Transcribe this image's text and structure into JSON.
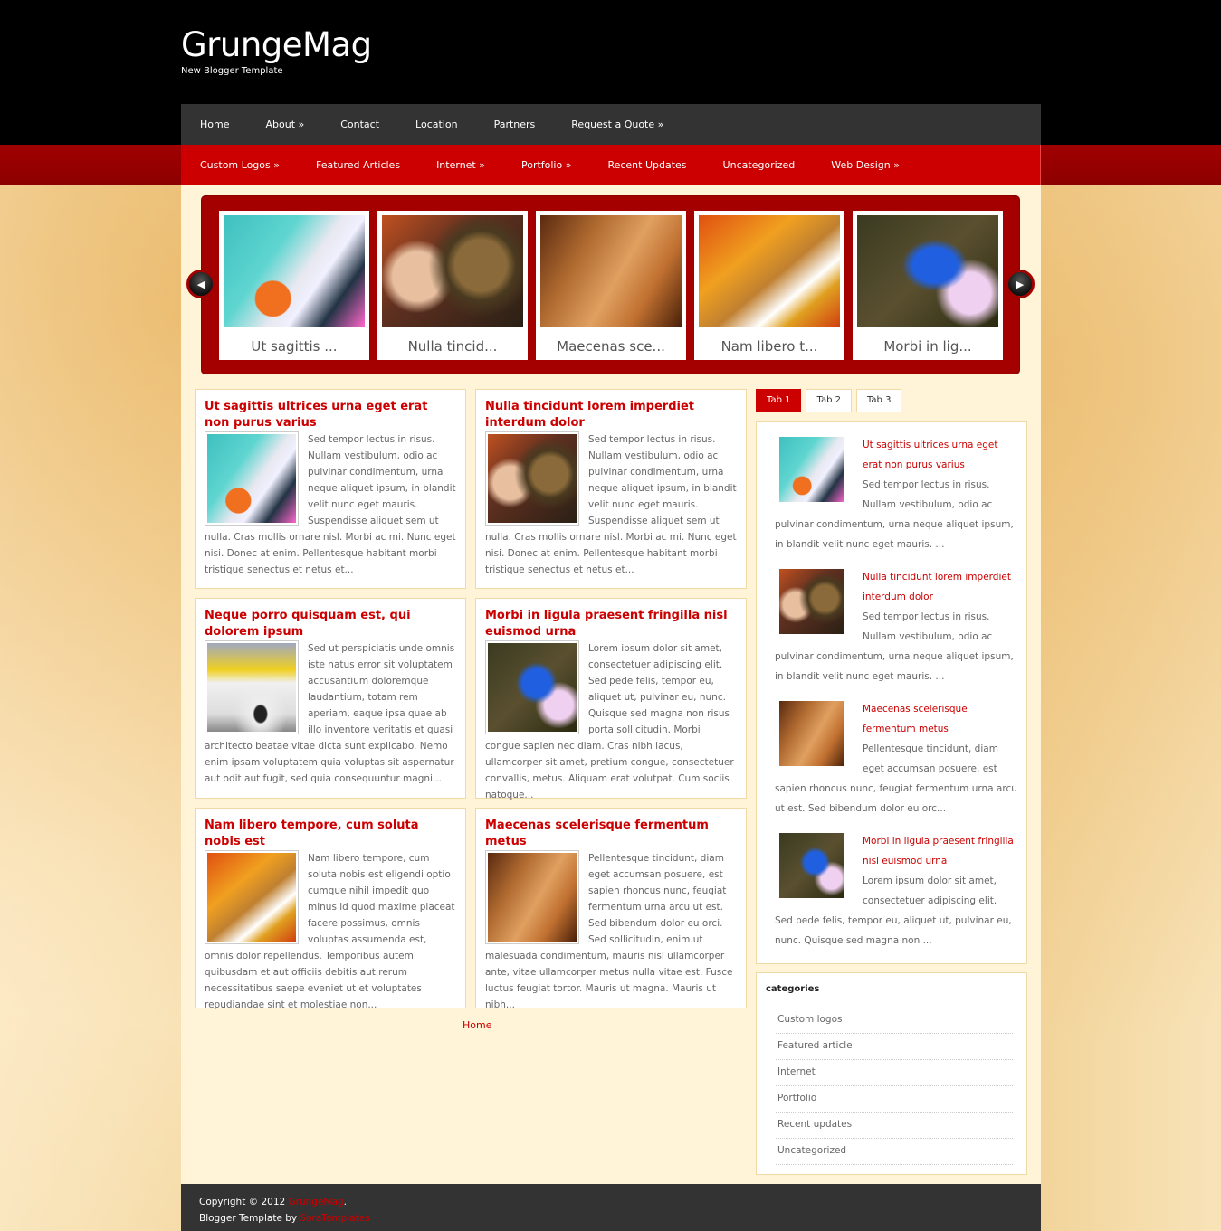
{
  "header": {
    "logo": "GrungeMag",
    "tagline": "New Blogger Template"
  },
  "nav_primary": [
    {
      "label": "Home"
    },
    {
      "label": "About »"
    },
    {
      "label": "Contact"
    },
    {
      "label": "Location"
    },
    {
      "label": "Partners"
    },
    {
      "label": "Request a Quote »"
    }
  ],
  "nav_secondary": [
    {
      "label": "Custom Logos »"
    },
    {
      "label": "Featured Articles"
    },
    {
      "label": "Internet »"
    },
    {
      "label": "Portfolio »"
    },
    {
      "label": "Recent Updates"
    },
    {
      "label": "Uncategorized"
    },
    {
      "label": "Web Design »"
    }
  ],
  "slider": {
    "prev_icon": "triangle-left",
    "next_icon": "triangle-right",
    "slides": [
      {
        "caption": "Ut sagittis ..."
      },
      {
        "caption": "Nulla tincid..."
      },
      {
        "caption": "Maecenas sce..."
      },
      {
        "caption": "Nam libero t..."
      },
      {
        "caption": "Morbi in lig..."
      }
    ]
  },
  "posts": [
    {
      "title": "Ut sagittis ultrices urna eget erat non purus varius",
      "excerpt": "Sed tempor lectus in risus. Nullam vestibulum, odio ac pulvinar condimentum, urna neque aliquet ipsum, in blandit velit nunc eget mauris. Suspendisse aliquet sem ut nulla. Cras mollis ornare nisl. Morbi ac mi. Nunc eget nisi. Donec at enim. Pellentesque habitant morbi tristique senectus et netus et..."
    },
    {
      "title": "Nulla tincidunt lorem imperdiet interdum dolor",
      "excerpt": "Sed tempor lectus in risus. Nullam vestibulum, odio ac pulvinar condimentum, urna neque aliquet ipsum, in blandit velit nunc eget mauris. Suspendisse aliquet sem ut nulla. Cras mollis ornare nisl. Morbi ac mi. Nunc eget nisi. Donec at enim. Pellentesque habitant morbi tristique senectus et netus et..."
    },
    {
      "title": "Neque porro quisquam est, qui dolorem ipsum",
      "excerpt": "Sed ut perspiciatis unde omnis iste natus error sit voluptatem accusantium doloremque laudantium, totam rem aperiam, eaque ipsa quae ab illo inventore veritatis et quasi architecto beatae vitae dicta sunt explicabo. Nemo enim ipsam voluptatem quia voluptas sit aspernatur aut odit aut fugit, sed quia consequuntur magni..."
    },
    {
      "title": "Morbi in ligula praesent fringilla nisl euismod urna",
      "excerpt": "Lorem ipsum dolor sit amet, consectetuer adipiscing elit. Sed pede felis, tempor eu, aliquet ut, pulvinar eu, nunc. Quisque sed magna non risus porta sollicitudin. Morbi congue sapien nec diam. Cras nibh lacus, ullamcorper sit amet, pretium congue, consectetuer convallis, metus. Aliquam erat volutpat. Cum sociis natoque..."
    },
    {
      "title": "Nam libero tempore, cum soluta nobis est",
      "excerpt": "Nam libero tempore, cum soluta nobis est eligendi optio cumque nihil impedit quo minus id quod maxime placeat facere possimus, omnis voluptas assumenda est, omnis dolor repellendus. Temporibus autem quibusdam et aut officiis debitis aut rerum necessitatibus saepe eveniet ut et voluptates repudiandae sint et molestiae non..."
    },
    {
      "title": "Maecenas scelerisque fermentum metus",
      "excerpt": "Pellentesque tincidunt, diam eget accumsan posuere, est sapien rhoncus nunc, feugiat fermentum urna arcu ut est. Sed bibendum dolor eu orci. Sed sollicitudin, enim ut malesuada condimentum, mauris nisl ullamcorper ante, vitae ullamcorper metus nulla vitae est. Fusce luctus feugiat tortor. Mauris ut magna. Mauris ut nibh..."
    }
  ],
  "pager": {
    "home_label": "Home"
  },
  "sidebar": {
    "tabs": [
      {
        "label": "Tab 1",
        "active": true
      },
      {
        "label": "Tab 2",
        "active": false
      },
      {
        "label": "Tab 3",
        "active": false
      }
    ],
    "tab_items": [
      {
        "title": "Ut sagittis ultrices urna eget erat non purus varius",
        "excerpt": "Sed tempor lectus in risus. Nullam vestibulum, odio ac pulvinar condimentum, urna neque aliquet ipsum, in blandit velit nunc eget mauris. ..."
      },
      {
        "title": "Nulla tincidunt lorem imperdiet interdum dolor",
        "excerpt": "Sed tempor lectus in risus. Nullam vestibulum, odio ac pulvinar condimentum, urna neque aliquet ipsum, in blandit velit nunc eget mauris. ..."
      },
      {
        "title": "Maecenas scelerisque fermentum metus",
        "excerpt": "Pellentesque tincidunt, diam eget accumsan posuere, est sapien rhoncus nunc, feugiat fermentum urna arcu ut est. Sed bibendum dolor eu orc..."
      },
      {
        "title": "Morbi in ligula praesent fringilla nisl euismod urna",
        "excerpt": "Lorem ipsum dolor sit amet, consectetuer adipiscing elit. Sed pede felis, tempor eu, aliquet ut, pulvinar eu, nunc. Quisque sed magna non ..."
      }
    ],
    "categories": {
      "title": "categories",
      "items": [
        {
          "label": "Custom logos"
        },
        {
          "label": "Featured article"
        },
        {
          "label": "Internet"
        },
        {
          "label": "Portfolio"
        },
        {
          "label": "Recent updates"
        },
        {
          "label": "Uncategorized"
        }
      ]
    }
  },
  "footer": {
    "copyright_prefix": "Copyright © 2012 ",
    "site_link": "GrungeMag",
    "copyright_suffix": ".",
    "credit_prefix": "Blogger Template by ",
    "credit_link": "SoraTemplates"
  },
  "colors": {
    "accent_red": "#cc0000",
    "dark_nav": "#333333",
    "slider_bg": "#a50000",
    "content_bg": "#fff3d8"
  }
}
